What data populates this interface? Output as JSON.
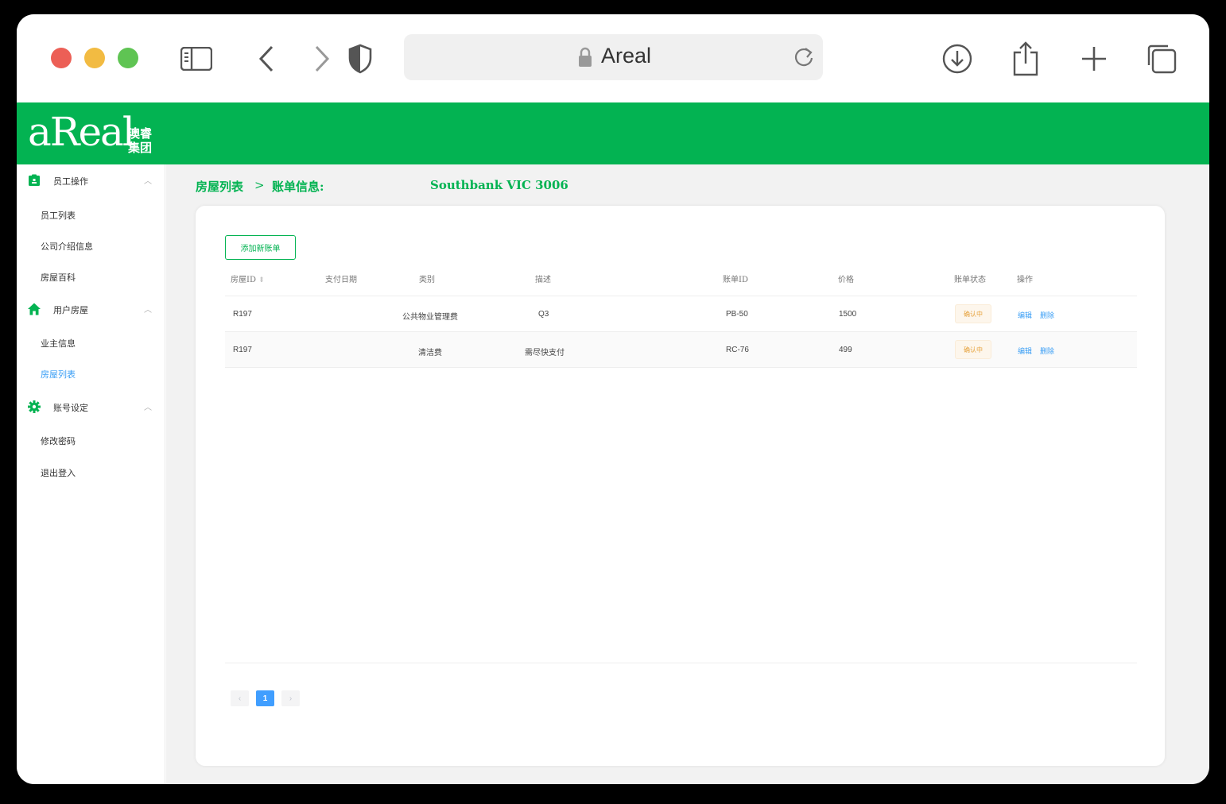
{
  "browser": {
    "address_text": "Areal"
  },
  "brand": {
    "logo_text": "aReal",
    "logo_cn": "澳睿集团"
  },
  "sidebar": {
    "groups": [
      {
        "label": "员工操作",
        "items": [
          "员工列表",
          "公司介绍信息",
          "房屋百科"
        ]
      },
      {
        "label": "用户房屋",
        "items": [
          "业主信息",
          "房屋列表"
        ]
      },
      {
        "label": "账号设定",
        "items": [
          "修改密码",
          "退出登入"
        ]
      }
    ],
    "active_item": "房屋列表"
  },
  "breadcrumb": {
    "root": "房屋列表",
    "separator": ">",
    "current": "账单信息:",
    "address": "Southbank VIC 3006"
  },
  "toolbar": {
    "add_label": "添加新账单"
  },
  "table": {
    "columns": [
      "房屋ID",
      "支付日期",
      "类别",
      "描述",
      "账单ID",
      "价格",
      "账单状态",
      "操作"
    ],
    "rows": [
      {
        "house_id": "R197",
        "pay_date": "",
        "category": "公共物业管理费",
        "description": "Q3",
        "bill_id": "PB-50",
        "price": "1500",
        "status": "确认中",
        "edit": "编辑",
        "delete": "删除"
      },
      {
        "house_id": "R197",
        "pay_date": "",
        "category": "清洁费",
        "description": "需尽快支付",
        "bill_id": "RC-76",
        "price": "499",
        "status": "确认中",
        "edit": "编辑",
        "delete": "删除"
      }
    ]
  },
  "pagination": {
    "prev": "‹",
    "current_page": "1",
    "next": "›"
  },
  "colors": {
    "brand_green": "#03b352",
    "link_blue": "#3a9ef5",
    "status_orange": "#e6a23c"
  }
}
